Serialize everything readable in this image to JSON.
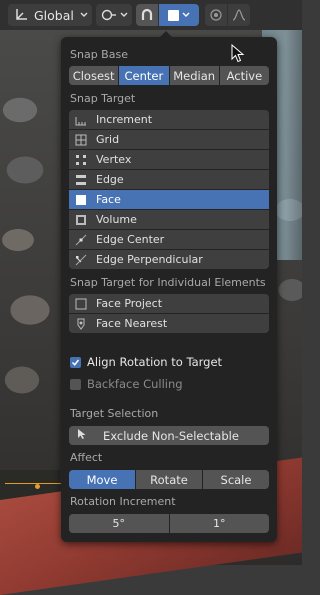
{
  "header": {
    "orientation_label": "Global",
    "pivot_icon": "transform-pivot-icon",
    "snap_toggle_icon": "magnet-icon",
    "snap_target_icon": "face-snap-icon",
    "proportional_icon": "proportional-edit-icon",
    "falloff_icon": "falloff-curve-icon"
  },
  "popover": {
    "snap_base": {
      "label": "Snap Base",
      "options": [
        "Closest",
        "Center",
        "Median",
        "Active"
      ],
      "selected": "Center"
    },
    "snap_target": {
      "label": "Snap Target",
      "items": [
        {
          "label": "Increment",
          "icon": "increment-icon",
          "active": false
        },
        {
          "label": "Grid",
          "icon": "grid-icon",
          "active": false
        },
        {
          "label": "Vertex",
          "icon": "vertex-icon",
          "active": false
        },
        {
          "label": "Edge",
          "icon": "edge-icon",
          "active": false
        },
        {
          "label": "Face",
          "icon": "face-icon",
          "active": true
        },
        {
          "label": "Volume",
          "icon": "volume-icon",
          "active": false
        },
        {
          "label": "Edge Center",
          "icon": "edge-center-icon",
          "active": false
        },
        {
          "label": "Edge Perpendicular",
          "icon": "edge-perpendicular-icon",
          "active": false
        }
      ]
    },
    "individual": {
      "label": "Snap Target for Individual Elements",
      "items": [
        {
          "label": "Face Project",
          "icon": "face-project-icon",
          "active": false
        },
        {
          "label": "Face Nearest",
          "icon": "face-nearest-icon",
          "active": false
        }
      ]
    },
    "align_rotation": {
      "label": "Align Rotation to Target",
      "checked": true
    },
    "backface_culling": {
      "label": "Backface Culling",
      "checked": false
    },
    "target_selection": {
      "label": "Target Selection",
      "button_label": "Exclude Non-Selectable"
    },
    "affect": {
      "label": "Affect",
      "options": [
        "Move",
        "Rotate",
        "Scale"
      ],
      "selected": "Move"
    },
    "rotation_increment": {
      "label": "Rotation Increment",
      "values": [
        "5°",
        "1°"
      ]
    }
  },
  "colors": {
    "accent": "#4772b3",
    "panel": "#232323",
    "item": "#3f3f3f"
  }
}
